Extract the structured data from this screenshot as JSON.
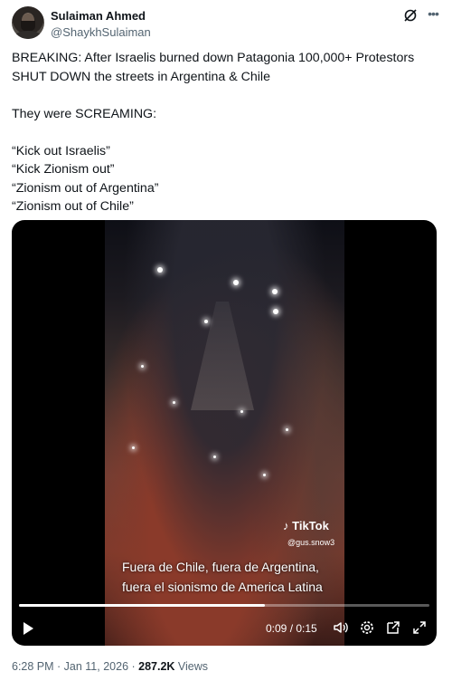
{
  "author": {
    "name": "Sulaiman Ahmed",
    "handle": "@ShaykhSulaiman",
    "avatar_icon": "avatar"
  },
  "header_icons": [
    "grok-icon",
    "more-icon"
  ],
  "tweet": {
    "lines": [
      "BREAKING: After Israelis burned down Patagonia 100,000+ Protestors",
      "SHUT DOWN the streets in Argentina & Chile",
      "",
      "They were SCREAMING:",
      "",
      "“Kick out Israelis”",
      "“Kick Zionism out”",
      "“Zionism out of Argentina”",
      "“Zionism out of Chile”"
    ]
  },
  "video": {
    "watermark": "TikTok",
    "watermark_user": "@gus.snow3",
    "caption_line1": "Fuera de Chile, fuera de Argentina,",
    "caption_line2": "fuera el sionismo de America Latina",
    "time": "0:09 / 0:15",
    "progress": 0.6,
    "controls": [
      "play-icon",
      "volume-icon",
      "settings-icon",
      "popout-icon",
      "fullscreen-icon"
    ]
  },
  "meta": {
    "time": "6:28 PM · Jan 11, 2026 · ",
    "views_count": "287.2K",
    "views_label": " Views"
  }
}
